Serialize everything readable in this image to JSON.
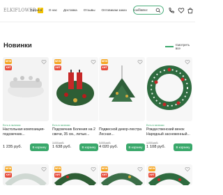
{
  "header": {
    "logo": "ELKIFLOWER",
    "logo_badge": "Ё",
    "nav": [
      "Каталог",
      "О нас",
      "Доставка",
      "Отзывы",
      "Оптовикам заказ",
      "Контакты"
    ],
    "search_placeholder": "Поиск"
  },
  "section": {
    "title": "Новинки",
    "see_all": "Смотреть все"
  },
  "products": [
    {
      "badge_new": "NEW",
      "badge_hit": "ХИТ",
      "availability": "Есть в наличии",
      "name": "Настольная композиция-подсвечник...",
      "old_price": "",
      "price": "1 235 руб.",
      "cart": "В корзину",
      "colors": {
        "bg": "#f4f4f4",
        "main": "#dcdcdc"
      }
    },
    {
      "badge_new": "NEW",
      "badge_hit": "ХИТ",
      "availability": "Есть в наличии",
      "name": "Подсвечник Боления на 2 свечи, 35 см., литые...",
      "old_price": "2 000 руб.",
      "price": "1 638 руб.",
      "cart": "В корзину",
      "colors": {
        "bg": "#f8f8f8",
        "main": "#c62828"
      }
    },
    {
      "badge_new": "NEW",
      "badge_hit": "ХИТ",
      "availability": "",
      "name": "Подвесной декор-люстра Лесная...",
      "old_price": "5 000 руб.",
      "price": "4 020 руб.",
      "cart": "В корзину",
      "colors": {
        "bg": "#f8f8f8",
        "main": "#2f5e3a"
      }
    },
    {
      "badge_new": "",
      "badge_hit": "",
      "availability": "Есть в наличии",
      "name": "Рождественский венок Нарядный заснеженный...",
      "old_price": "1 500 руб.",
      "price": "1 108 руб.",
      "cart": "В корзину",
      "colors": {
        "bg": "#f8f8f8",
        "main": "#2e6b3f"
      }
    }
  ],
  "bottom_row": [
    {
      "badge_new": "NEW",
      "badge_hit": "ХИТ"
    },
    {
      "badge_new": "NEW",
      "badge_hit": "ХИТ"
    },
    {
      "badge_new": "NEW",
      "badge_hit": "ХИТ"
    },
    {
      "badge_new": "NEW",
      "badge_hit": "ХИТ"
    }
  ]
}
